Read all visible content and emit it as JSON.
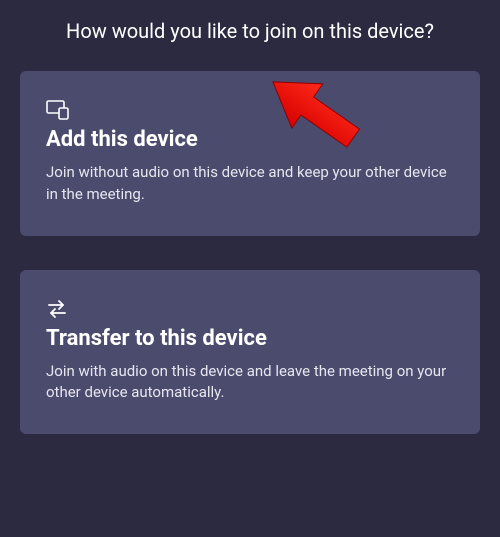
{
  "heading": "How would you like to join on this device?",
  "options": [
    {
      "title": "Add this device",
      "description": "Join without audio on this device and keep your other device in the meeting."
    },
    {
      "title": "Transfer to this device",
      "description": "Join with audio on this device and leave the meeting on your other device automatically."
    }
  ]
}
